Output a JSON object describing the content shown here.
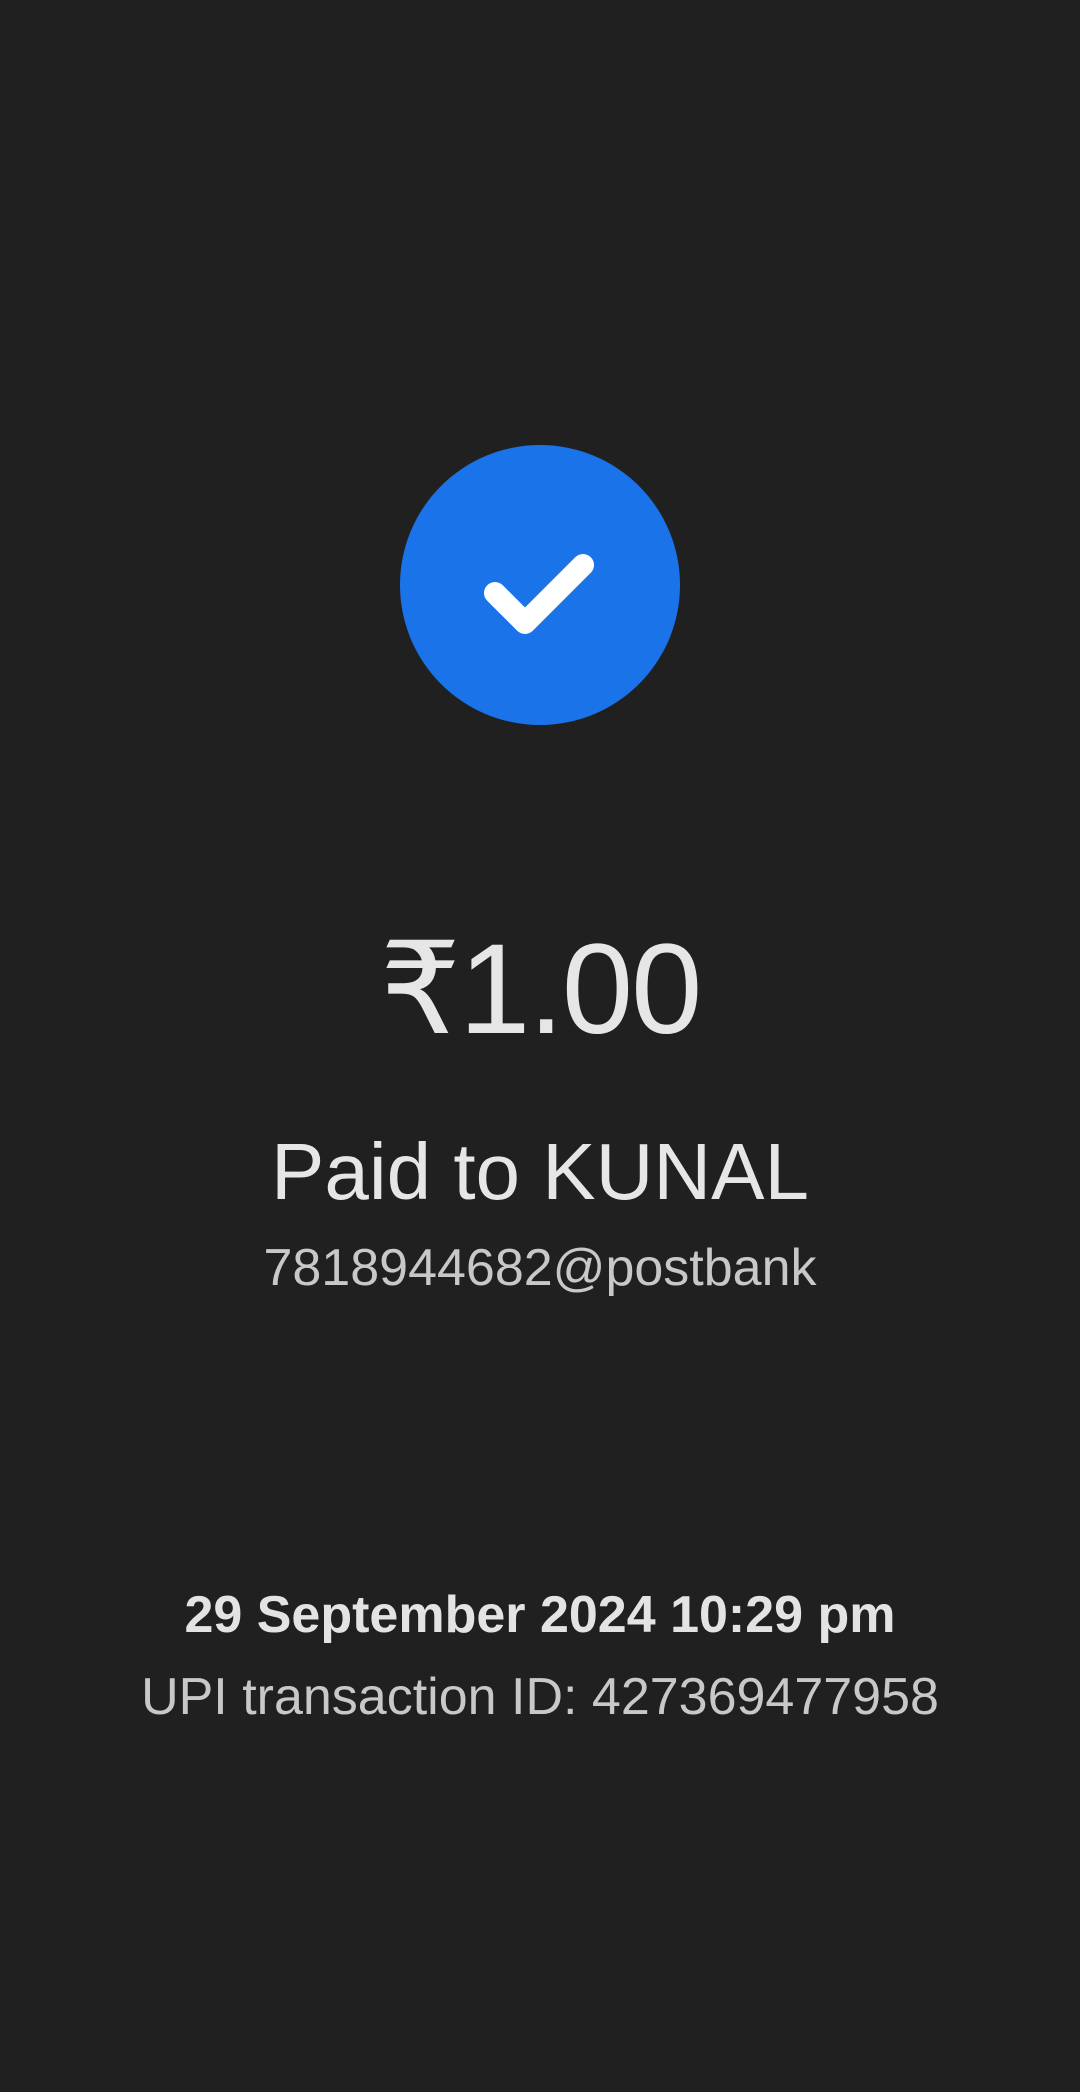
{
  "status": {
    "icon": "checkmark-icon",
    "color": "#1a73e8"
  },
  "payment": {
    "amount": "₹1.00",
    "paid_to": "Paid to KUNAL",
    "upi_handle": "7818944682@postbank"
  },
  "details": {
    "datetime": "29 September 2024 10:29 pm",
    "transaction_id": "UPI transaction ID: 427369477958"
  }
}
